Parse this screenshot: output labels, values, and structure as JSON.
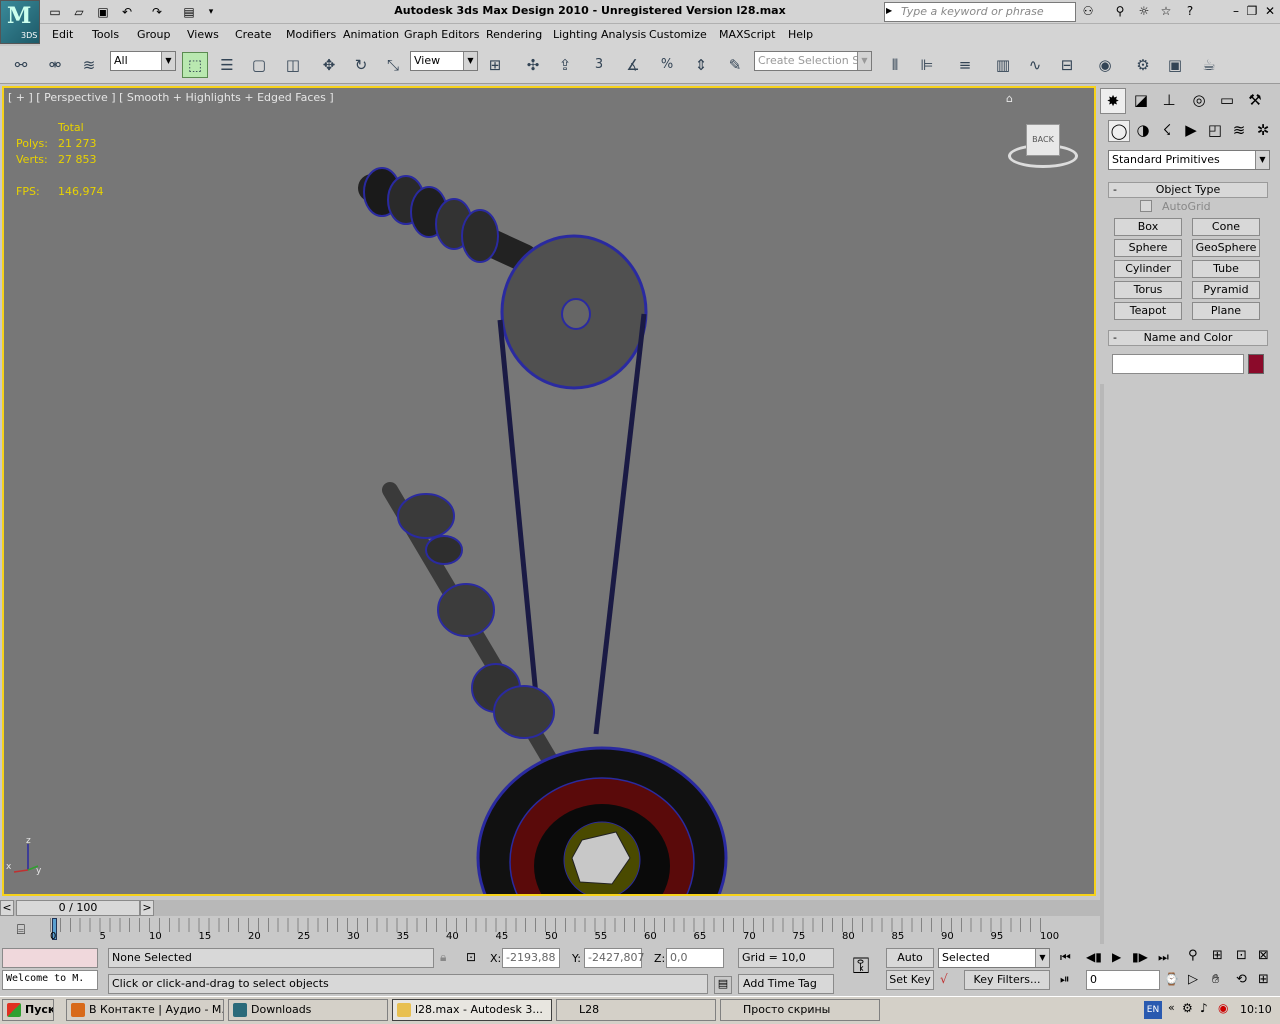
{
  "window": {
    "title": "Autodesk 3ds Max Design 2010   -  Unregistered Version     l28.max",
    "search_placeholder": "Type a keyword or phrase",
    "logo_text": "3DS"
  },
  "menu": [
    "Edit",
    "Tools",
    "Group",
    "Views",
    "Create",
    "Modifiers",
    "Animation",
    "Graph Editors",
    "Rendering",
    "Lighting Analysis",
    "Customize",
    "MAXScript",
    "Help"
  ],
  "toolbar": {
    "selection_filter": "All",
    "ref_coord": "View",
    "named_selection_placeholder": "Create Selection Se",
    "snap_label": "3",
    "spinner_label": "%"
  },
  "viewport": {
    "label": "[ + ] [ Perspective ] [ Smooth + Highlights + Edged Faces ]",
    "stats": {
      "header": "Total",
      "polys_label": "Polys:",
      "polys": "21 273",
      "verts_label": "Verts:",
      "verts": "27 853",
      "fps_label": "FPS:",
      "fps": "146,974"
    },
    "viewcube_label": "BACK",
    "axis_z": "z",
    "axis_x": "x",
    "axis_y": "y"
  },
  "command_panel": {
    "category": "Standard Primitives",
    "object_type_title": "Object Type",
    "autogrid_label": "AutoGrid",
    "buttons": [
      "Box",
      "Cone",
      "Sphere",
      "GeoSphere",
      "Cylinder",
      "Tube",
      "Torus",
      "Pyramid",
      "Teapot",
      "Plane"
    ],
    "name_color_title": "Name and Color",
    "name_value": "",
    "object_color": "#8b0a2a"
  },
  "timeline": {
    "frame_display": "0 / 100",
    "prev_label": "<",
    "next_label": ">",
    "ticks": [
      "0",
      "5",
      "10",
      "15",
      "20",
      "25",
      "30",
      "35",
      "40",
      "45",
      "50",
      "55",
      "60",
      "65",
      "70",
      "75",
      "80",
      "85",
      "90",
      "95",
      "100"
    ]
  },
  "status": {
    "maxscript_listener": "Welcome to M.",
    "selection": "None Selected",
    "prompt": "Click or click-and-drag to select objects",
    "x_label": "X:",
    "x_value": "-2193,88",
    "y_label": "Y:",
    "y_value": "-2427,807",
    "z_label": "Z:",
    "z_value": "0,0",
    "grid": "Grid = 10,0",
    "add_time_tag": "Add Time Tag",
    "auto_key": "Auto Key",
    "set_key": "Set Key",
    "key_mode": "Selected",
    "key_filters": "Key Filters...",
    "current_frame": "0"
  },
  "taskbar": {
    "start": "Пуск",
    "tasks": [
      {
        "label": "В Контакте | Аудио - М...",
        "color": "#d86a1a"
      },
      {
        "label": "Downloads",
        "color": "#d86a1a"
      },
      {
        "label": "l28.max - Autodesk 3...",
        "color": "#2a6a7a"
      },
      {
        "label": "L28",
        "color": "#e8c050"
      },
      {
        "label": "Просто скрины",
        "color": "#e8c050"
      }
    ],
    "lang": "EN",
    "clock": "10:10"
  },
  "colors": {
    "viewport_bg": "#777777",
    "active_border": "#f6d21a",
    "stats_text": "#e8d200",
    "wire": "#2a2aa0"
  }
}
